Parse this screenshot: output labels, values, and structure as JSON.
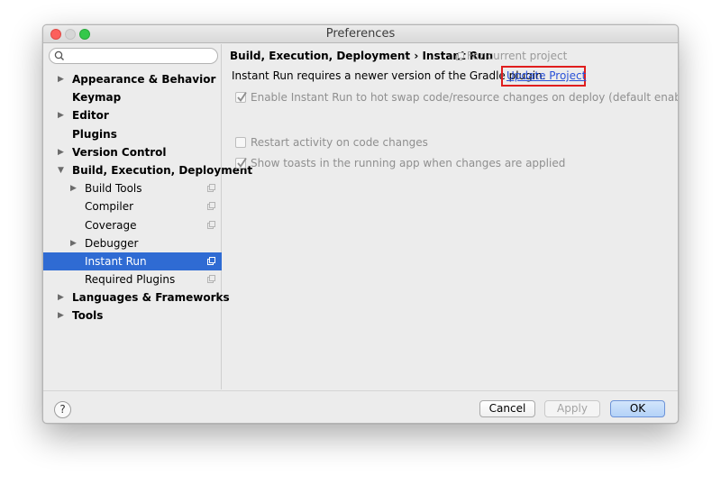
{
  "window": {
    "title": "Preferences"
  },
  "search": {
    "value": "",
    "placeholder": ""
  },
  "sidebar": {
    "items": [
      {
        "label": "Appearance & Behavior",
        "arrow": "▶",
        "bold": true,
        "level": 0,
        "project_icon": false,
        "selected": false
      },
      {
        "label": "Keymap",
        "arrow": "",
        "bold": true,
        "level": 0,
        "project_icon": false,
        "selected": false
      },
      {
        "label": "Editor",
        "arrow": "▶",
        "bold": true,
        "level": 0,
        "project_icon": false,
        "selected": false
      },
      {
        "label": "Plugins",
        "arrow": "",
        "bold": true,
        "level": 0,
        "project_icon": false,
        "selected": false
      },
      {
        "label": "Version Control",
        "arrow": "▶",
        "bold": true,
        "level": 0,
        "project_icon": false,
        "selected": false
      },
      {
        "label": "Build, Execution, Deployment",
        "arrow": "▼",
        "bold": true,
        "level": 0,
        "project_icon": false,
        "selected": false
      },
      {
        "label": "Build Tools",
        "arrow": "▶",
        "bold": false,
        "level": 1,
        "project_icon": true,
        "selected": false
      },
      {
        "label": "Compiler",
        "arrow": "",
        "bold": false,
        "level": 1,
        "project_icon": true,
        "selected": false
      },
      {
        "label": "Coverage",
        "arrow": "",
        "bold": false,
        "level": 1,
        "project_icon": true,
        "selected": false
      },
      {
        "label": "Debugger",
        "arrow": "▶",
        "bold": false,
        "level": 1,
        "project_icon": false,
        "selected": false
      },
      {
        "label": "Instant Run",
        "arrow": "",
        "bold": false,
        "level": 1,
        "project_icon": true,
        "selected": true
      },
      {
        "label": "Required Plugins",
        "arrow": "",
        "bold": false,
        "level": 1,
        "project_icon": true,
        "selected": false
      },
      {
        "label": "Languages & Frameworks",
        "arrow": "▶",
        "bold": true,
        "level": 0,
        "project_icon": false,
        "selected": false
      },
      {
        "label": "Tools",
        "arrow": "▶",
        "bold": true,
        "level": 0,
        "project_icon": false,
        "selected": false
      }
    ]
  },
  "content": {
    "breadcrumb": "Build, Execution, Deployment › Instant Run",
    "scope_label": "For current project",
    "notice": "Instant Run requires a newer version of the Gradle plugin.",
    "update_link": "Update Project",
    "options": [
      {
        "label": "Enable Instant Run to hot swap code/resource changes on deploy (default enabled)",
        "checked": true,
        "enabled": false
      },
      {
        "label": "Restart activity on code changes",
        "checked": false,
        "enabled": false
      },
      {
        "label": "Show toasts in the running app when changes are applied",
        "checked": true,
        "enabled": false
      }
    ]
  },
  "footer": {
    "help_label": "?",
    "cancel_label": "Cancel",
    "apply_label": "Apply",
    "ok_label": "OK"
  },
  "colors": {
    "selection": "#2f6bd3",
    "link": "#2a52d8",
    "highlight_border": "#e01e1e"
  }
}
